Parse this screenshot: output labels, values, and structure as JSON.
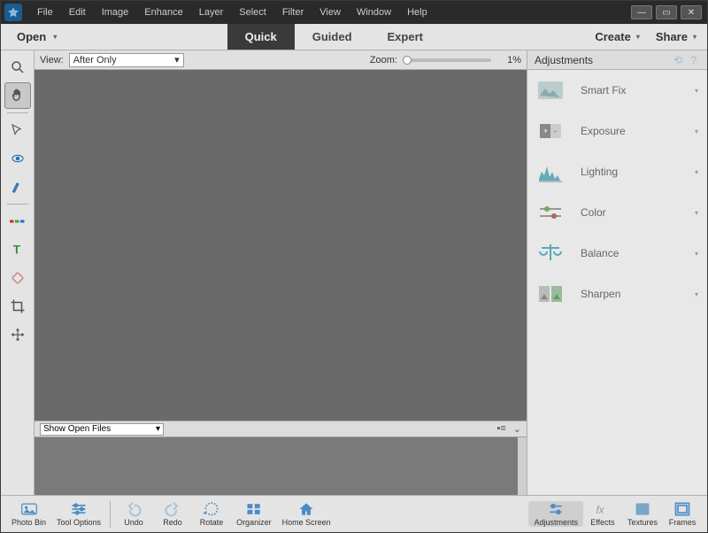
{
  "menus": [
    "File",
    "Edit",
    "Image",
    "Enhance",
    "Layer",
    "Select",
    "Filter",
    "View",
    "Window",
    "Help"
  ],
  "open_label": "Open",
  "modes": {
    "quick": "Quick",
    "guided": "Guided",
    "expert": "Expert"
  },
  "create_label": "Create",
  "share_label": "Share",
  "options": {
    "view_label": "View:",
    "view_value": "After Only",
    "zoom_label": "Zoom:",
    "zoom_value": "1%"
  },
  "bin": {
    "select_value": "Show Open Files"
  },
  "panel": {
    "title": "Adjustments",
    "items": [
      "Smart Fix",
      "Exposure",
      "Lighting",
      "Color",
      "Balance",
      "Sharpen"
    ]
  },
  "bottom": {
    "photo_bin": "Photo Bin",
    "tool_options": "Tool Options",
    "undo": "Undo",
    "redo": "Redo",
    "rotate": "Rotate",
    "organizer": "Organizer",
    "home": "Home Screen",
    "adjustments": "Adjustments",
    "effects": "Effects",
    "textures": "Textures",
    "frames": "Frames"
  }
}
